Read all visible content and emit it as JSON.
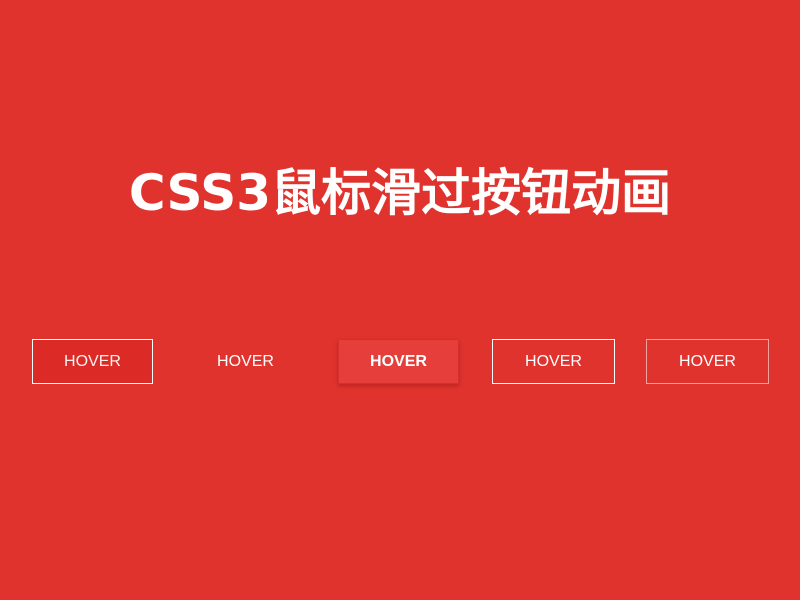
{
  "title": "CSS3鼠标滑过按钮动画",
  "buttons": [
    {
      "label": "HOVER"
    },
    {
      "label": "HOVER"
    },
    {
      "label": "HOVER"
    },
    {
      "label": "HOVER"
    },
    {
      "label": "HOVER"
    }
  ],
  "colors": {
    "background": "#e0332e",
    "text": "#ffffff"
  }
}
